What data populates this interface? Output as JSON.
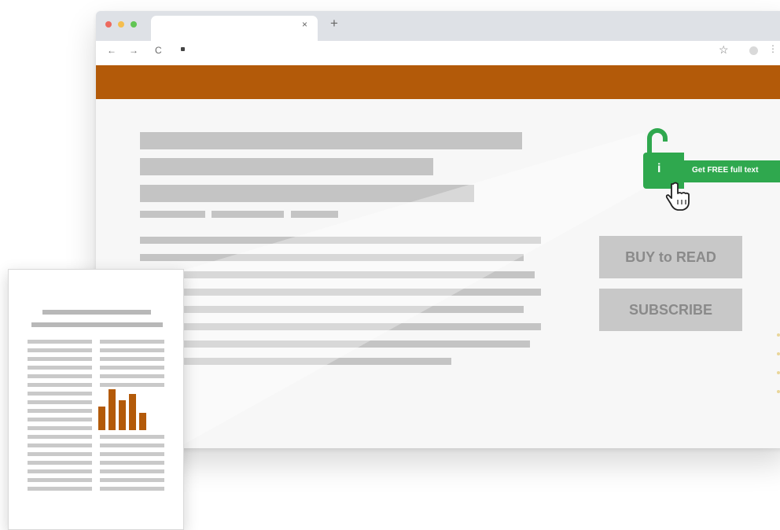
{
  "browser": {
    "tab_close": "×",
    "new_tab": "+",
    "nav_back": "←",
    "nav_forward": "→",
    "nav_reload": "C",
    "bookmark_star": "☆",
    "menu": "⋮",
    "traffic_lights": [
      "#ed6a5e",
      "#f5be4f",
      "#61c554"
    ]
  },
  "colors": {
    "banner": "#b35a09",
    "unlock_green": "#2fa84e",
    "placeholder_gray": "#c4c4c4",
    "chart_bars": "#b35a09"
  },
  "sidebar": {
    "unlock_label": "Get FREE full text",
    "keyhole_glyph": "i",
    "buy_button": "BUY to READ",
    "subscribe_button": "SUBSCRIBE"
  },
  "doc_thumbnail": {
    "chart_icon": "bar-chart-icon"
  }
}
